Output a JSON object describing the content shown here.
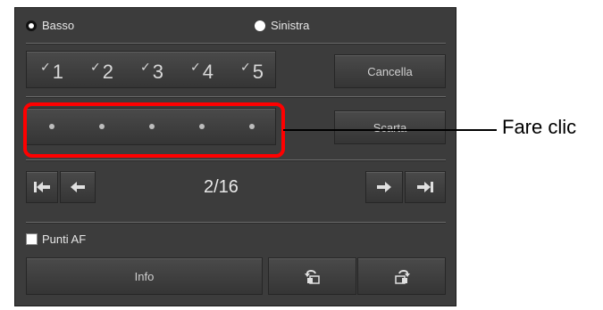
{
  "position_options": [
    {
      "label": "Basso",
      "selected": true
    },
    {
      "label": "Sinistra",
      "selected": false
    }
  ],
  "rating_labels": [
    "1",
    "2",
    "3",
    "4",
    "5"
  ],
  "buttons": {
    "cancel_label": "Cancella",
    "discard_label": "Scarta",
    "info_label": "Info"
  },
  "navigation": {
    "counter": "2/16"
  },
  "af_points": {
    "label": "Punti AF",
    "checked": false
  },
  "annotation": {
    "callout_text": "Fare clic"
  },
  "icons": {
    "first": "first-image-icon",
    "prev": "previous-image-icon",
    "next": "next-image-icon",
    "last": "last-image-icon",
    "rotate_left": "rotate-left-icon",
    "rotate_right": "rotate-right-icon"
  },
  "colors": {
    "panel": "#3c3c3c",
    "highlight": "#ff0000",
    "text": "#e6e6e6"
  }
}
